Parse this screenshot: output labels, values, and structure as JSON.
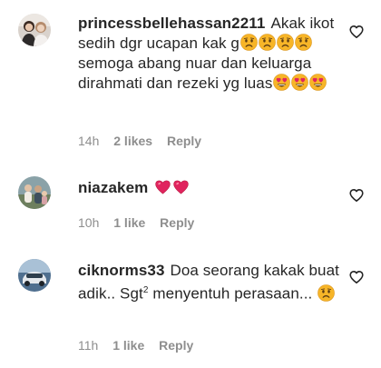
{
  "comments": [
    {
      "username": "princessbellehassan2211",
      "text_1": "Akak ikot sedih dgr ucapan kak g",
      "text_2": "semoga abang nuar dan keluarga dirahmati dan rezeki yg luas",
      "time": "14h",
      "likes": "2 likes",
      "reply": "Reply"
    },
    {
      "username": "niazakem",
      "time": "10h",
      "likes": "1 like",
      "reply": "Reply"
    },
    {
      "username": "ciknorms33",
      "text_1": "Doa seorang kakak buat adik.. Sgt",
      "superscript": "2",
      "text_2": "menyentuh perasaan...",
      "time": "11h",
      "likes": "1 like",
      "reply": "Reply"
    }
  ],
  "icons": {
    "sad_face": "sad-face-emoji",
    "heart_eyes": "heart-eyes-emoji",
    "red_heart": "red-heart-emoji",
    "like": "heart-outline-icon"
  },
  "colors": {
    "text": "#262626",
    "meta": "#8e8e8e",
    "emoji_yellow": "#f7b528",
    "heart_red": "#e0245e"
  }
}
